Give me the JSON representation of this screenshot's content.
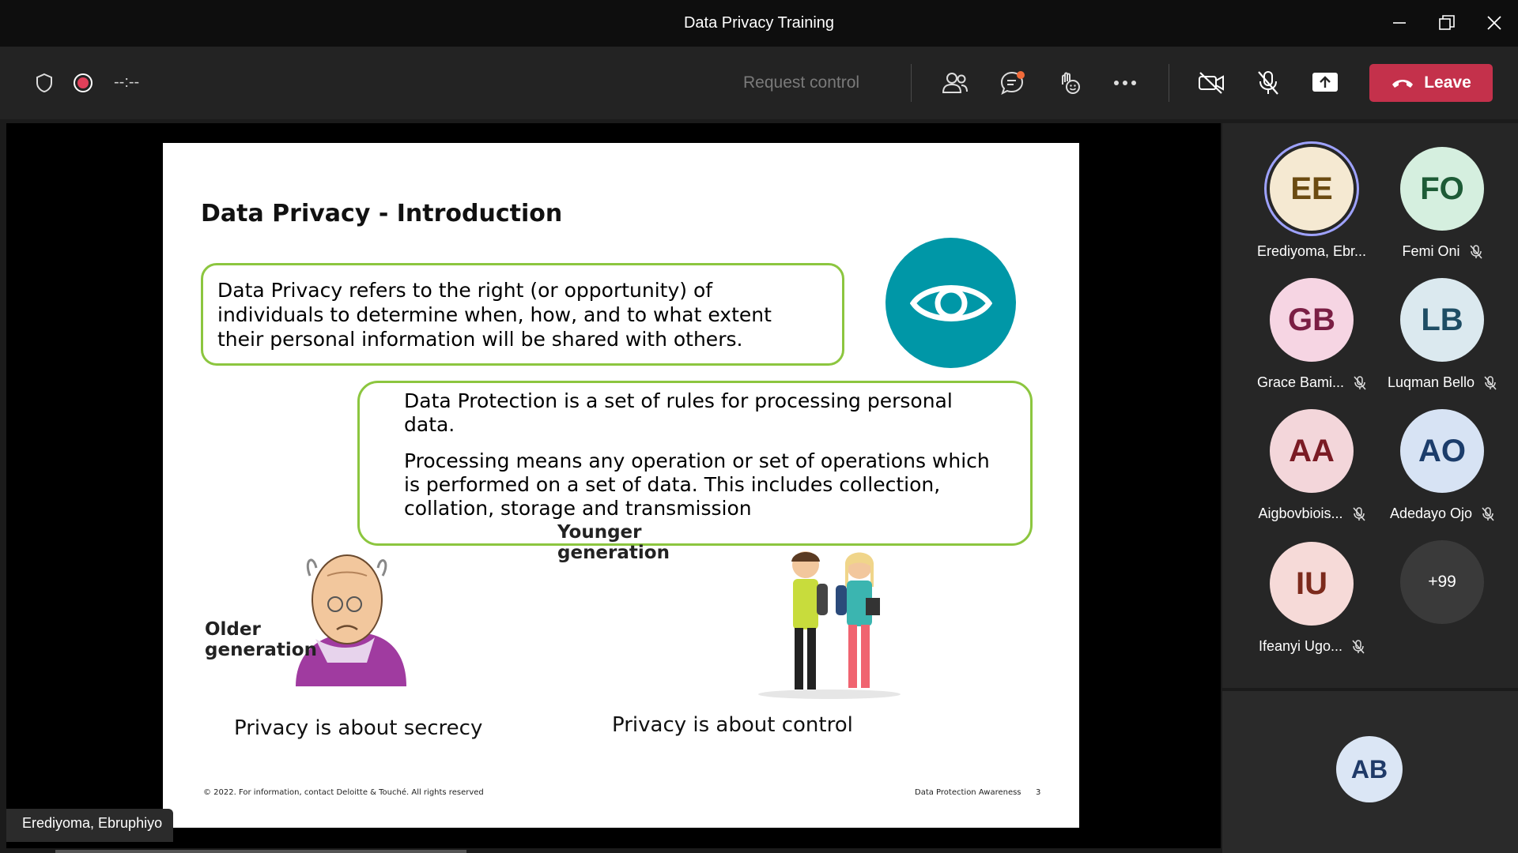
{
  "window": {
    "title": "Data Privacy Training"
  },
  "toolbar": {
    "timer": "--:--",
    "request_control": "Request control",
    "leave_label": "Leave",
    "icons": [
      "shield-icon",
      "record-icon",
      "people-icon",
      "chat-icon",
      "react-icon",
      "more-icon",
      "camera-off-icon",
      "mic-off-icon",
      "share-icon",
      "phone-hangup-icon"
    ]
  },
  "slide": {
    "title": "Data Privacy - Introduction",
    "definition": [
      "Data Privacy refers to the right (or opportunity) of",
      "individuals to determine when, how, and to what extent",
      "their personal information will be shared with others."
    ],
    "protection_p1": [
      "Data Protection is a set of rules for processing personal",
      "data."
    ],
    "protection_p2": [
      "Processing means any operation or set of operations which",
      "is performed on a set of data.  This includes collection,",
      "collation, storage and transmission"
    ],
    "older_label": [
      "Older",
      "generation"
    ],
    "younger_label": [
      "Younger",
      "generation"
    ],
    "older_caption": "Privacy is about secrecy",
    "younger_caption": "Privacy is about control",
    "footer_left": "© 2022. For information, contact Deloitte & Touché. All rights reserved",
    "footer_right": "Data Protection Awareness",
    "page_number": "3"
  },
  "presenter_tag": "Erediyoma, Ebruphiyo",
  "participants": [
    {
      "initials": "EE",
      "name": "Erediyoma, Ebr...",
      "bg": "#f5e9d2",
      "fg": "#6b4b12",
      "muted": false,
      "speaking": true
    },
    {
      "initials": "FO",
      "name": "Femi Oni",
      "bg": "#d5efdf",
      "fg": "#1d5b36",
      "muted": true,
      "speaking": false
    },
    {
      "initials": "GB",
      "name": "Grace Bami...",
      "bg": "#f6d5e3",
      "fg": "#7a1e44",
      "muted": true,
      "speaking": false
    },
    {
      "initials": "LB",
      "name": "Luqman Bello",
      "bg": "#dbe9ef",
      "fg": "#1e4d64",
      "muted": true,
      "speaking": false
    },
    {
      "initials": "AA",
      "name": "Aigbovbiois...",
      "bg": "#f3d6da",
      "fg": "#7a1b24",
      "muted": true,
      "speaking": false
    },
    {
      "initials": "AO",
      "name": "Adedayo Ojo",
      "bg": "#d7e3f4",
      "fg": "#1c3d6b",
      "muted": true,
      "speaking": false
    },
    {
      "initials": "IU",
      "name": "Ifeanyi Ugo...",
      "bg": "#f6dad8",
      "fg": "#7c2a1c",
      "muted": true,
      "speaking": false
    }
  ],
  "more_participants": "+99",
  "self": {
    "initials": "AB"
  },
  "colors": {
    "leave": "#c4314b",
    "accent_green": "#8cc63f",
    "eye_teal": "#0097a7",
    "speaking_ring": "#9ea2ff"
  }
}
